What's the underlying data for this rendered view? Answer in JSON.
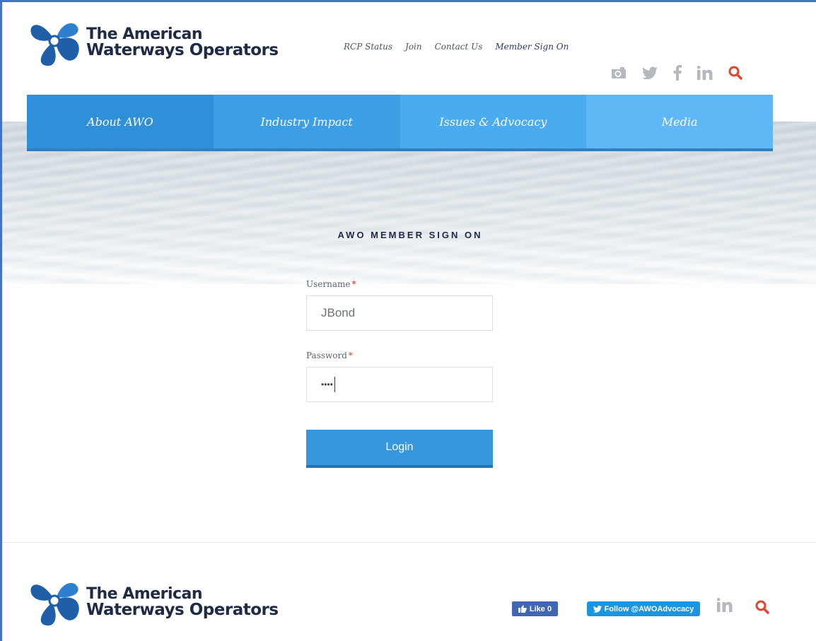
{
  "header": {
    "logo_line1": "The American",
    "logo_line2": "Waterways Operators",
    "top_links": [
      "RCP Status",
      "Join",
      "Contact Us",
      "Member Sign On"
    ],
    "social_icons": [
      "camera-icon",
      "twitter-icon",
      "facebook-icon",
      "linkedin-icon",
      "search-icon"
    ]
  },
  "nav": {
    "items": [
      "About AWO",
      "Industry Impact",
      "Issues & Advocacy",
      "Media"
    ]
  },
  "form": {
    "heading": "AWO MEMBER SIGN ON",
    "username_label": "Username",
    "username_value": "JBond",
    "password_label": "Password",
    "password_value": "••••",
    "required_mark": "*",
    "login_label": "Login"
  },
  "footer": {
    "logo_line1": "The American",
    "logo_line2": "Waterways Operators",
    "like_label": "Like 0",
    "follow_label": "Follow @AWOAdvocacy"
  },
  "colors": {
    "brand_blue": "#2f8fd8",
    "logo_blue": "#1e5fa8",
    "accent_red": "#d9342b"
  }
}
